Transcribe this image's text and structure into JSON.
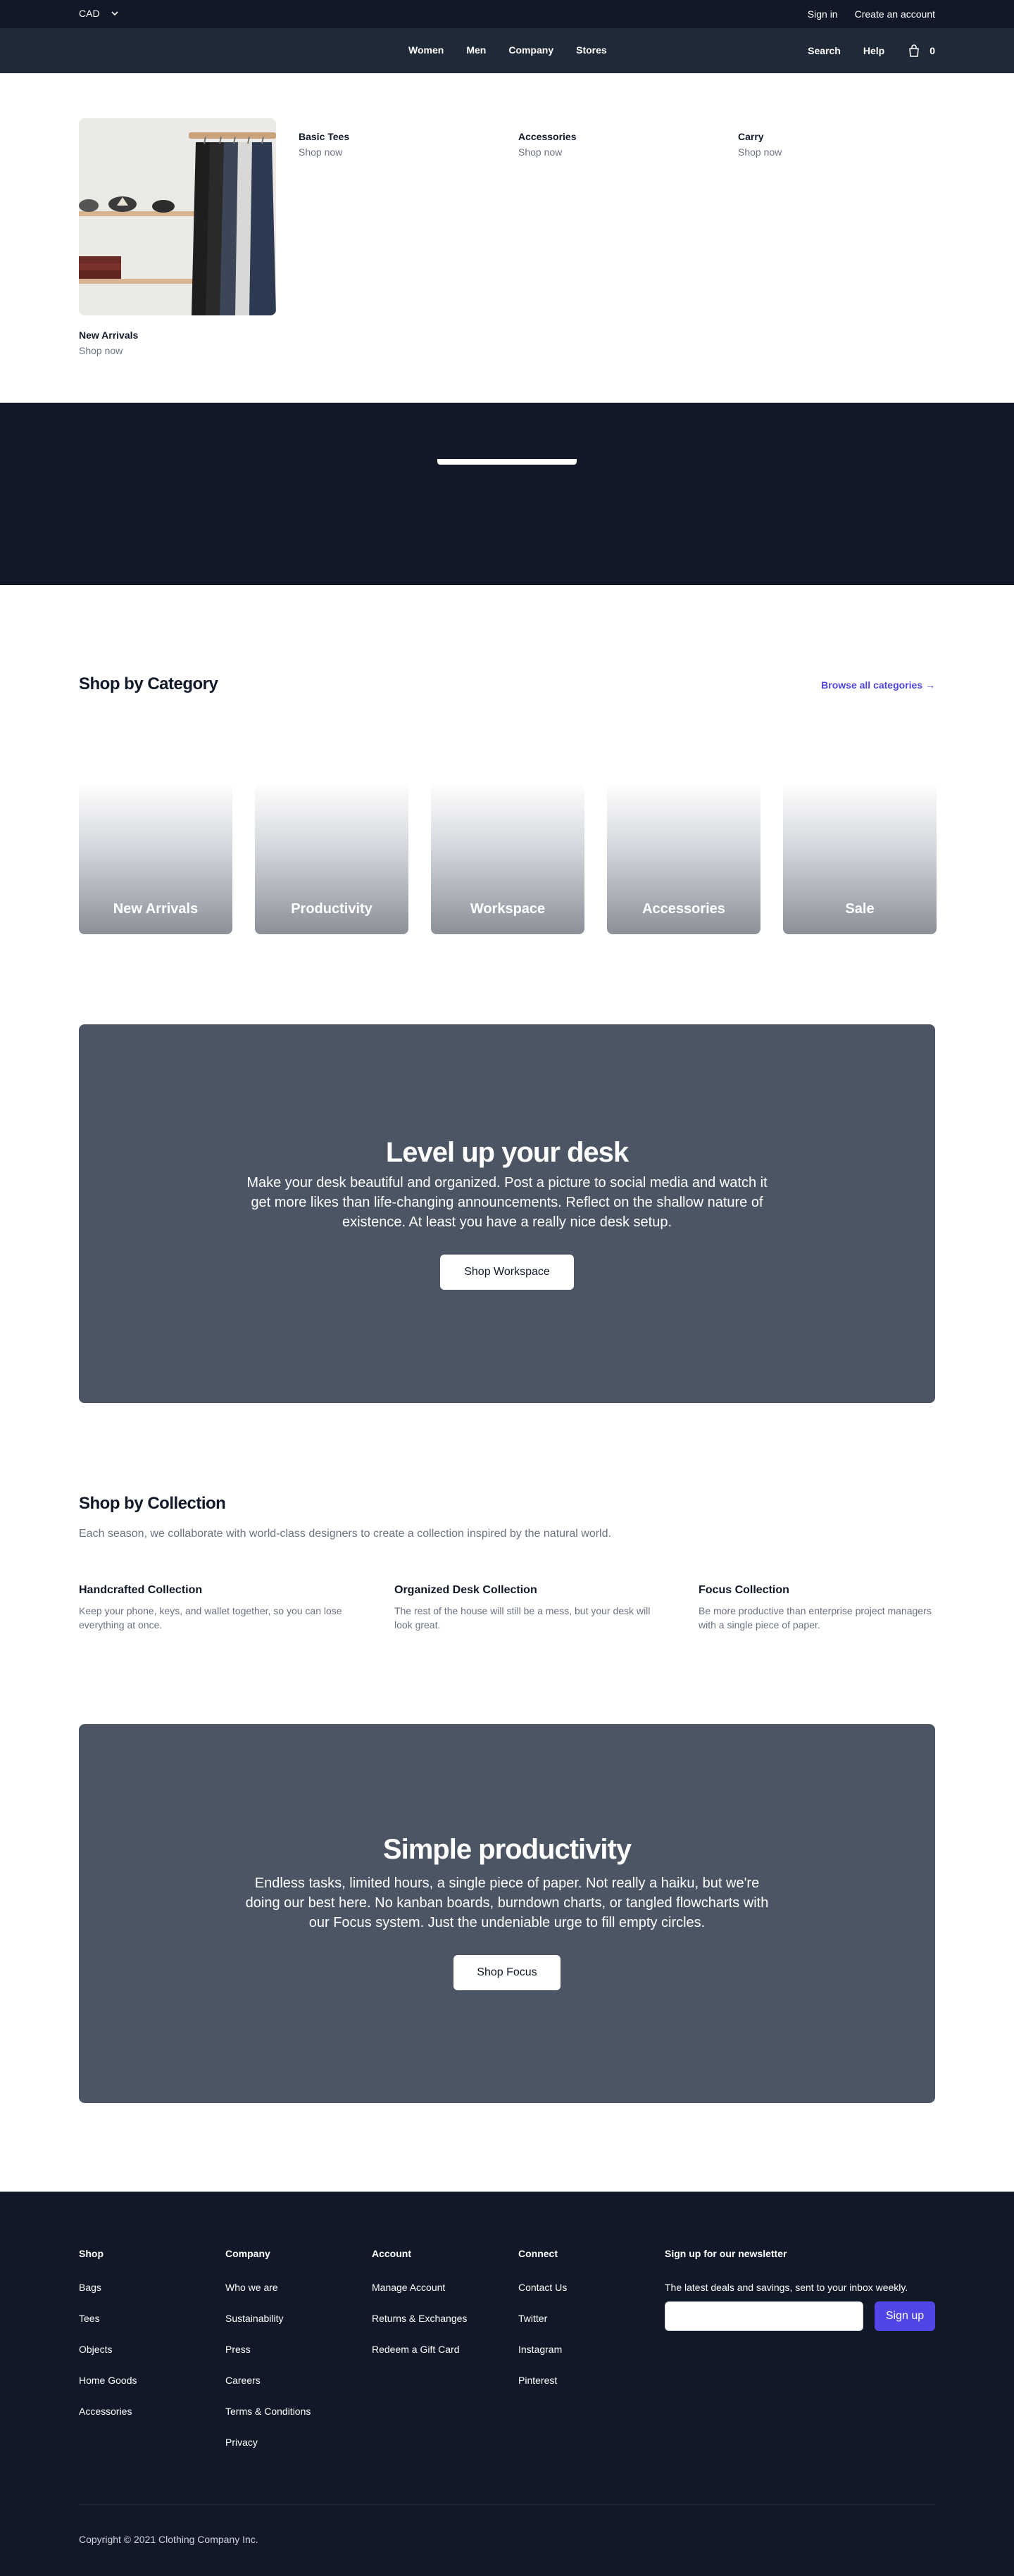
{
  "topbar": {
    "currency": "CAD",
    "sign_in": "Sign in",
    "create_account": "Create an account"
  },
  "nav": {
    "items": [
      "Women",
      "Men",
      "Company",
      "Stores"
    ],
    "search": "Search",
    "help": "Help",
    "cart_count": "0"
  },
  "flyout": {
    "featured": {
      "title": "New Arrivals",
      "cta": "Shop now"
    },
    "columns": [
      {
        "title": "Basic Tees",
        "cta": "Shop now"
      },
      {
        "title": "Accessories",
        "cta": "Shop now"
      },
      {
        "title": "Carry",
        "cta": "Shop now"
      }
    ]
  },
  "category": {
    "title": "Shop by Category",
    "browse_link": "Browse all categories →",
    "cards": [
      "New Arrivals",
      "Productivity",
      "Workspace",
      "Accessories",
      "Sale"
    ]
  },
  "promo1": {
    "title": "Level up your desk",
    "body": "Make your desk beautiful and organized. Post a picture to social media and watch it get more likes than life-changing announcements. Reflect on the shallow nature of existence. At least you have a really nice desk setup.",
    "button": "Shop Workspace"
  },
  "collection": {
    "title": "Shop by Collection",
    "description": "Each season, we collaborate with world-class designers to create a collection inspired by the natural world.",
    "items": [
      {
        "title": "Handcrafted Collection",
        "text": "Keep your phone, keys, and wallet together, so you can lose everything at once."
      },
      {
        "title": "Organized Desk Collection",
        "text": "The rest of the house will still be a mess, but your desk will look great."
      },
      {
        "title": "Focus Collection",
        "text": "Be more productive than enterprise project managers with a single piece of paper."
      }
    ]
  },
  "promo2": {
    "title": "Simple productivity",
    "body": "Endless tasks, limited hours, a single piece of paper. Not really a haiku, but we're doing our best here. No kanban boards, burndown charts, or tangled flowcharts with our Focus system. Just the undeniable urge to fill empty circles.",
    "button": "Shop Focus"
  },
  "footer": {
    "columns": [
      {
        "title": "Shop",
        "links": [
          "Bags",
          "Tees",
          "Objects",
          "Home Goods",
          "Accessories"
        ]
      },
      {
        "title": "Company",
        "links": [
          "Who we are",
          "Sustainability",
          "Press",
          "Careers",
          "Terms & Conditions",
          "Privacy"
        ]
      },
      {
        "title": "Account",
        "links": [
          "Manage Account",
          "Returns & Exchanges",
          "Redeem a Gift Card"
        ]
      },
      {
        "title": "Connect",
        "links": [
          "Contact Us",
          "Twitter",
          "Instagram",
          "Pinterest"
        ]
      }
    ],
    "newsletter": {
      "title": "Sign up for our newsletter",
      "text": "The latest deals and savings, sent to your inbox weekly.",
      "input_value": "",
      "button": "Sign up"
    },
    "copyright": "Copyright © 2021 Clothing Company Inc."
  },
  "colors": {
    "accent": "#4f46e5",
    "dark": "#111827",
    "nav": "#1f2937",
    "panel": "#4b5563"
  }
}
